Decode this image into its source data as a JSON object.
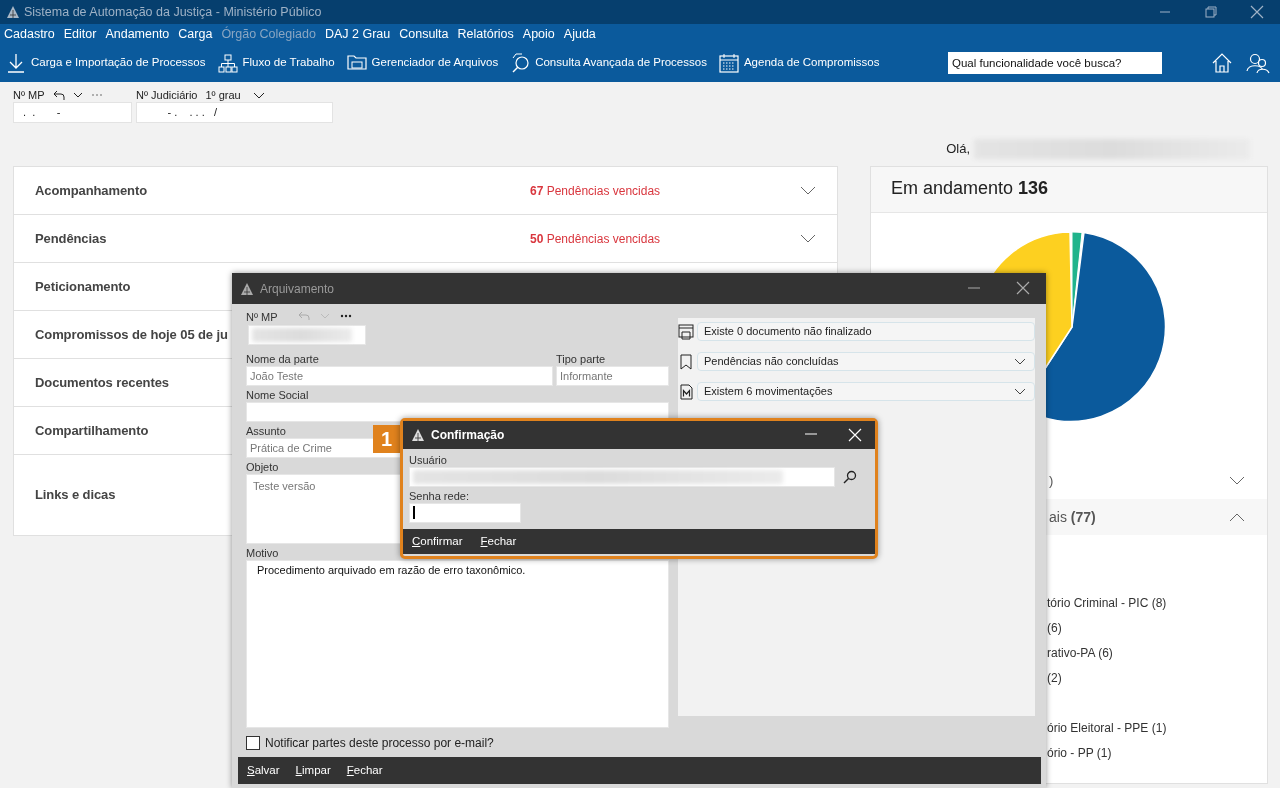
{
  "window": {
    "title": "Sistema de Automação da Justiça - Ministério Público"
  },
  "menu": [
    {
      "label": "Cadastro",
      "disabled": false
    },
    {
      "label": "Editor",
      "disabled": false
    },
    {
      "label": "Andamento",
      "disabled": false
    },
    {
      "label": "Carga",
      "disabled": false
    },
    {
      "label": "Órgão Colegiado",
      "disabled": true
    },
    {
      "label": "DAJ 2 Grau",
      "disabled": false
    },
    {
      "label": "Consulta",
      "disabled": false
    },
    {
      "label": "Relatórios",
      "disabled": false
    },
    {
      "label": "Apoio",
      "disabled": false
    },
    {
      "label": "Ajuda",
      "disabled": false
    }
  ],
  "toolbar": [
    {
      "label": "Carga e Importação de Processos",
      "kind": "download"
    },
    {
      "label": "Fluxo de Trabalho",
      "kind": "hierarchy"
    },
    {
      "label": "Gerenciador de Arquivos",
      "kind": "folder"
    },
    {
      "label": "Consulta Avançada de Processos",
      "kind": "search"
    },
    {
      "label": "Agenda de Compromissos",
      "kind": "calendar"
    }
  ],
  "search": {
    "placeholder": "Qual funcionalidade você busca?"
  },
  "process_fields": {
    "mp_label": "Nº MP",
    "mp_value": " .  .       -",
    "judicial_label": "Nº Judiciário",
    "grade": "1º grau",
    "judicial_value": "        - .    . . .   /"
  },
  "greeting": "Olá,",
  "panels": [
    {
      "title": "Acompanhamento",
      "alert": "**67** Pendências vencidas"
    },
    {
      "title": "Pendências",
      "alert": "**50** Pendências vencidas"
    },
    {
      "title": "Peticionamento"
    },
    {
      "title": "Compromissos de hoje 05 de ju"
    },
    {
      "title": "Documentos recentes"
    },
    {
      "title": "Compartilhamento"
    },
    {
      "title": "Links e dicas"
    }
  ],
  "summary": {
    "title": "Em andamento **136**",
    "rows": [
      {
        "text": ")",
        "expanded": false
      },
      {
        "text": "ais **(77)**",
        "expanded": true
      }
    ],
    "groups": [
      [
        "tório Criminal - PIC (8)",
        "(6)",
        "rativo-PA (6)",
        "(2)"
      ],
      [
        "ório Eleitoral - PPE (1)",
        "ório - PP (1)"
      ]
    ]
  },
  "archive_window": {
    "title": "Arquivamento",
    "mp_label": "Nº MP",
    "party_label": "Nome da parte",
    "party_value": "João Teste",
    "party_type_label": "Tipo parte",
    "party_type_value": "Informante",
    "social_label": "Nome Social",
    "subject_label": "Assunto",
    "subject_value": "Prática de Crime",
    "object_label": "Objeto",
    "object_value": "Teste versão",
    "reason_label": "Motivo",
    "reason_value": "Procedimento arquivado em razão de erro taxonômico.",
    "notify": {
      "label": "Notificar partes deste processo por e-mail?",
      "checked": false
    },
    "info": [
      {
        "text": "Existe 0 documento não finalizado",
        "kind": "document",
        "expandable": false
      },
      {
        "text": "Pendências não concluídas",
        "kind": "bookmark",
        "expandable": true
      },
      {
        "text": "Existem 6 movimentações",
        "kind": "movement",
        "expandable": true
      }
    ],
    "buttons": [
      "Salvar",
      "Limpar",
      "Fechar"
    ]
  },
  "confirm_dialog": {
    "step": "1",
    "title": "Confirmação",
    "user_label": "Usuário",
    "password_label": "Senha rede:",
    "buttons": [
      "Confirmar",
      "Fechar"
    ]
  }
}
